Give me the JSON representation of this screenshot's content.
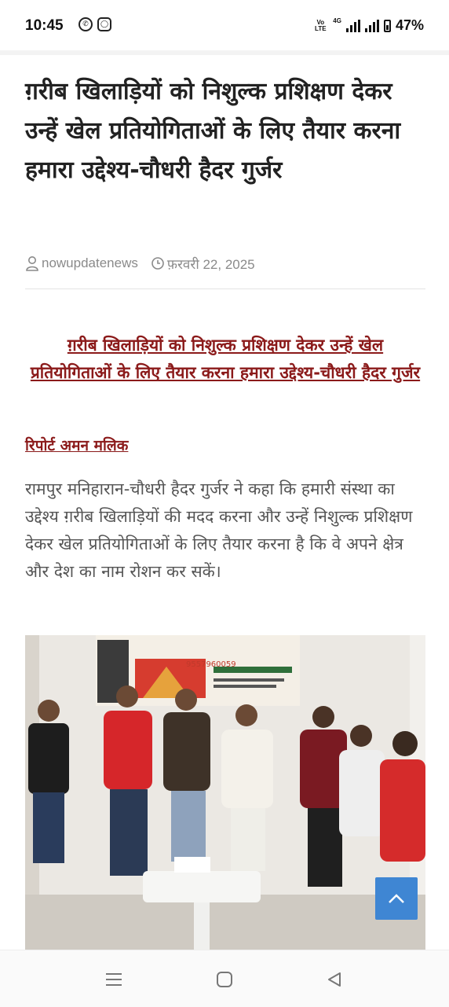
{
  "status_bar": {
    "time": "10:45",
    "app_icons": [
      "whatsapp-icon",
      "instagram-icon"
    ],
    "volte_label": "Vo LTE",
    "network_label": "4G",
    "battery": "47%"
  },
  "post": {
    "title": "ग़रीब खिलाड़ियों को निशुल्क प्रशिक्षण देकर उन्हें खेल प्रतियोगिताओं के लिए तैयार करना हमारा उद्देश्य-चौधरी हैदर गुर्जर",
    "author": "nowupdatenews",
    "date": "फ़रवरी 22, 2025",
    "sub_heading": "ग़रीब खिलाड़ियों को निशुल्क प्रशिक्षण देकर उन्हें खेल प्रतियोगिताओं के लिए तैयार करना हमारा उद्देश्य-चौधरी हैदर गुर्जर",
    "reporter": "रिपोर्ट अमन मलिक",
    "body": "रामपुर मनिहारान-चौधरी हैदर गुर्जर ने कहा कि हमारी संस्था का उद्देश्य ग़रीब खिलाड़ियों की मदद करना और उन्हें निशुल्क प्रशिक्षण देकर खेल प्रतियोगिताओं के लिए तैयार करना है कि वे अपने क्षेत्र और देश का नाम रोशन कर सकें।",
    "photo_banner_phone": "9557960059"
  },
  "colors": {
    "accent_red": "#8b1a1a",
    "scroll_button": "#3f86d3",
    "title_text": "#222222",
    "meta_text": "#8a8a8a"
  },
  "nav": {
    "icons": [
      "menu-icon",
      "home-icon",
      "back-icon"
    ]
  }
}
